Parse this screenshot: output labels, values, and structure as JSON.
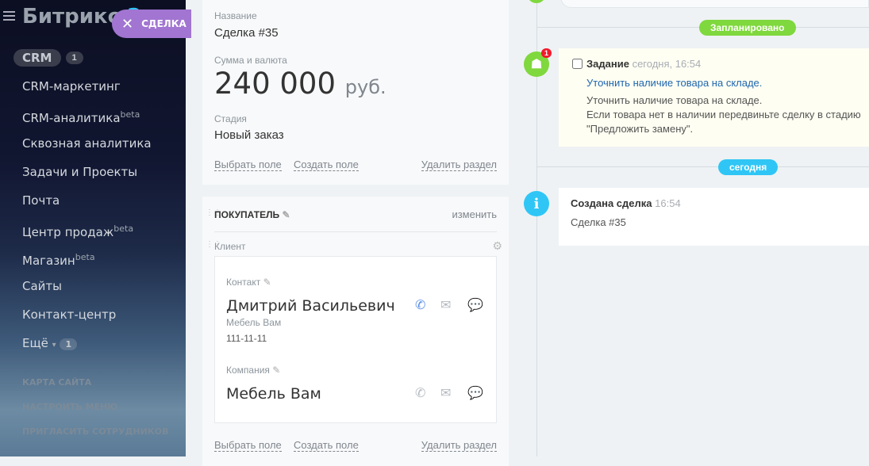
{
  "sidebar": {
    "logo": "Битрикс",
    "logo_suffix": "2",
    "crm": "CRM",
    "crm_count": "1",
    "items": [
      {
        "label": "CRM-маркетинг"
      },
      {
        "label": "CRM-аналитика",
        "beta": "beta"
      },
      {
        "label": "Сквозная аналитика"
      },
      {
        "label": "Задачи и Проекты"
      },
      {
        "label": "Почта"
      },
      {
        "label": "Центр продаж",
        "beta": "beta"
      },
      {
        "label": "Магазин",
        "beta": "beta"
      },
      {
        "label": "Сайты"
      },
      {
        "label": "Контакт-центр"
      },
      {
        "label": "Ещё",
        "count": "1"
      }
    ],
    "footer": [
      "КАРТА САЙТА",
      "НАСТРОИТЬ МЕНЮ",
      "ПРИГЛАСИТЬ СОТРУДНИКОВ"
    ]
  },
  "slider_tab": {
    "label": "СДЕЛКА"
  },
  "deal": {
    "name_label": "Название",
    "name": "Сделка #35",
    "sum_label": "Сумма и валюта",
    "sum": "240 000",
    "currency": "руб.",
    "stage_label": "Стадия",
    "stage": "Новый заказ",
    "select_field": "Выбрать поле",
    "create_field": "Создать поле",
    "delete_section": "Удалить раздел"
  },
  "buyer": {
    "title": "ПОКУПАТЕЛЬ",
    "change": "изменить",
    "client_label": "Клиент",
    "contact_label": "Контакт",
    "contact_name": "Дмитрий Васильевич",
    "contact_company": "Мебель Вам",
    "contact_phone": "111-11-11",
    "company_label": "Компания",
    "company_name": "Мебель Вам",
    "select_field": "Выбрать поле",
    "create_field": "Создать поле",
    "delete_section": "Удалить раздел"
  },
  "timeline": {
    "planned": "Запланировано",
    "task_badge": "1",
    "task_title": "Задание",
    "task_time": "сегодня, 16:54",
    "task_link": "Уточнить наличие товара на складе.",
    "task_desc": [
      "Уточнить наличие товара на складе.",
      "Если товара нет в наличии передвиньте сделку в стадию",
      "\"Предложить замену\"."
    ],
    "today": "сегодня",
    "created_title": "Создана сделка",
    "created_time": "16:54",
    "created_text": "Сделка #35"
  },
  "colors": {
    "green": "#7fd83d",
    "blue": "#2fc6f6",
    "purple": "#a175d1"
  }
}
